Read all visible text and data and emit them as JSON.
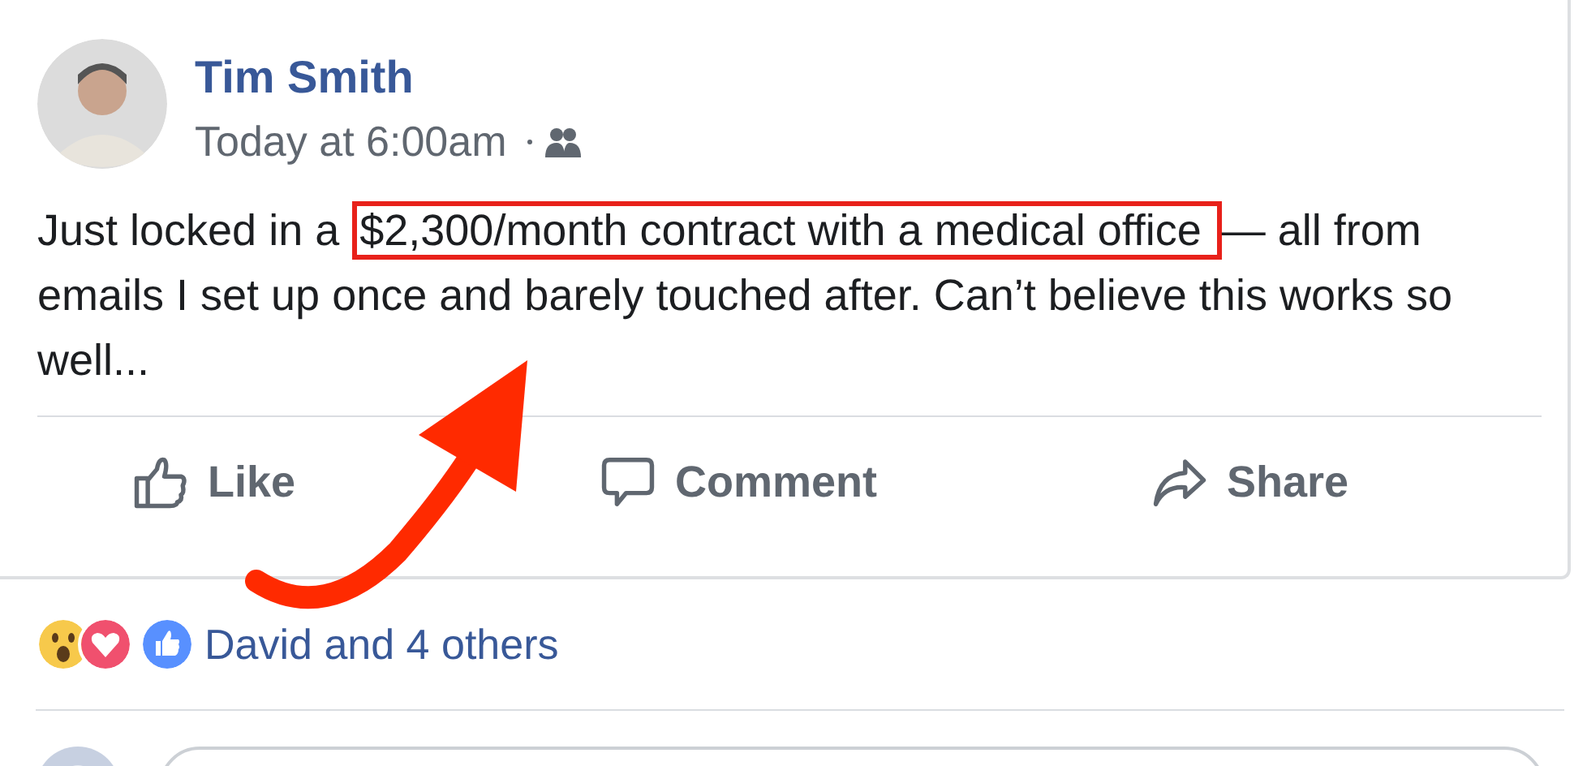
{
  "post": {
    "author": "Tim Smith",
    "time": "Today at 6:00am",
    "text_before": "Just locked in a ",
    "highlight": "$2,300/month contract with a medical office ",
    "text_after": "— all from emails I set up once and barely touched after. Can’t believe this works so well..."
  },
  "actions": [
    {
      "kind": "like",
      "label": "Like"
    },
    {
      "kind": "comment",
      "label": "Comment"
    },
    {
      "kind": "share",
      "label": "Share"
    }
  ],
  "reactions": {
    "summary": "David and 4 others"
  }
}
